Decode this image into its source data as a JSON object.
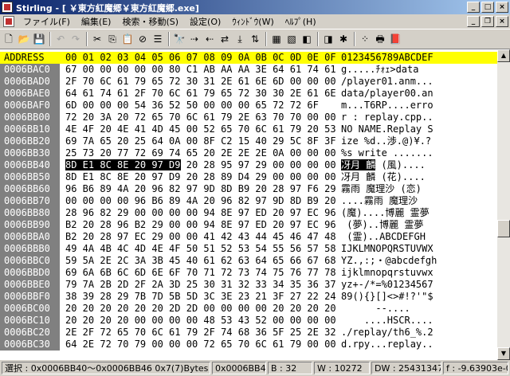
{
  "window": {
    "title": "Stirling - [ ￥東方紅魔郷￥東方紅魔郷.exe]",
    "minimize_icon": "minimize-icon",
    "maximize_icon": "maximize-icon",
    "close_icon": "close-icon"
  },
  "menu": {
    "items": [
      "ファイル(F)",
      "編集(E)",
      "検索・移動(S)",
      "設定(O)",
      "ｳｨﾝﾄﾞｳ(W)",
      "ﾍﾙﾌﾟ(H)"
    ]
  },
  "toolbar": {
    "icons": [
      "new-file-icon",
      "open-folder-icon",
      "save-icon",
      "undo-icon",
      "redo-icon",
      "cut-icon",
      "copy-icon",
      "paste-icon",
      "delete-icon",
      "select-all-icon",
      "find-icon",
      "find-next-icon",
      "find-prev-icon",
      "replace-icon",
      "jump-icon",
      "byte-order-icon",
      "insert-mode-icon",
      "overwrite-mode-icon",
      "prev-tag-icon",
      "next-tag-icon",
      "marker-icon",
      "random-icon",
      "print-icon",
      "help-book-icon"
    ]
  },
  "hex": {
    "header": {
      "address": "ADDRESS",
      "bytes": "00 01 02 03 04 05 06 07 08 09 0A 0B 0C 0D 0E 0F",
      "ascii": "0123456789ABCDEF"
    },
    "rows": [
      {
        "addr": "0006BAC0",
        "bytes": "67 00 00 00 00 00 80 C1 AB AA AA 3E 64 61 74 61",
        "ascii": "g.....ﾁｫｪ>data"
      },
      {
        "addr": "0006BAD0",
        "bytes": "2F 70 6C 61 79 65 72 30 31 2E 61 6E 6D 00 00 00",
        "ascii": "/player01.anm..."
      },
      {
        "addr": "0006BAE0",
        "bytes": "64 61 74 61 2F 70 6C 61 79 65 72 30 30 2E 61 6E",
        "ascii": "data/player00.an"
      },
      {
        "addr": "0006BAF0",
        "bytes": "6D 00 00 00 54 36 52 50 00 00 00 65 72 72 6F",
        "ascii": "m...T6RP....erro"
      },
      {
        "addr": "0006BB00",
        "bytes": "72 20 3A 20 72 65 70 6C 61 79 2E 63 70 70 00 00",
        "ascii": "r : replay.cpp.."
      },
      {
        "addr": "0006BB10",
        "bytes": "4E 4F 20 4E 41 4D 45 00 52 65 70 6C 61 79 20 53",
        "ascii": "NO NAME.Replay S"
      },
      {
        "addr": "0006BB20",
        "bytes": "69 7A 65 20 25 64 0A 00 8F C2 15 40 29 5C 8F 3F",
        "ascii": "ize %d..渉.@)¥.?"
      },
      {
        "addr": "0006BB30",
        "bytes": "25 73 20 77 72 69 74 65 20 2E 2E 2E 0A 00 00 00",
        "ascii": "%s write ......."
      },
      {
        "addr": "0006BB40",
        "bytes": "8D E1 8C 8E 20 97 D9 20 28 95 97 29 00 00 00 00",
        "ascii": "冴月 麟 (風)....",
        "sel_bytes": "8D E1 8C 8E 20 97 D9",
        "sel_ascii": "冴月 麟"
      },
      {
        "addr": "0006BB50",
        "bytes": "8D E1 8C 8E 20 97 D9 20 28 89 D4 29 00 00 00 00",
        "ascii": "冴月 麟 (花)...."
      },
      {
        "addr": "0006BB60",
        "bytes": "96 B6 89 4A 20 96 82 97 9D 8D B9 20 28 97 F6 29",
        "ascii": "霧雨 魔理沙 (恋)"
      },
      {
        "addr": "0006BB70",
        "bytes": "00 00 00 00 96 B6 89 4A 20 96 82 97 9D 8D B9 20",
        "ascii": "....霧雨 魔理沙 "
      },
      {
        "addr": "0006BB80",
        "bytes": "28 96 82 29 00 00 00 00 94 8E 97 ED 20 97 EC 96",
        "ascii": "(魔)....博麗 霊夢"
      },
      {
        "addr": "0006BB90",
        "bytes": "B2 20 28 96 B2 29 00 00 94 8E 97 ED 20 97 EC 96",
        "ascii": " (夢)..博麗 霊夢"
      },
      {
        "addr": "0006BBA0",
        "bytes": "B2 20 28 97 EC 29 00 00 41 42 43 44 45 46 47 48",
        "ascii": " (霊)..ABCDEFGH"
      },
      {
        "addr": "0006BBB0",
        "bytes": "49 4A 4B 4C 4D 4E 4F 50 51 52 53 54 55 56 57 58",
        "ascii": "IJKLMNOPQRSTUVWX"
      },
      {
        "addr": "0006BBC0",
        "bytes": "59 5A 2E 2C 3A 3B 45 40 61 62 63 64 65 66 67 68",
        "ascii": "YZ.,:;・@abcdefgh"
      },
      {
        "addr": "0006BBD0",
        "bytes": "69 6A 6B 6C 6D 6E 6F 70 71 72 73 74 75 76 77 78",
        "ascii": "ijklmnopqrstuvwx"
      },
      {
        "addr": "0006BBE0",
        "bytes": "79 7A 2B 2D 2F 2A 3D 25 30 31 32 33 34 35 36 37",
        "ascii": "yz+-/*=%01234567"
      },
      {
        "addr": "0006BBF0",
        "bytes": "38 39 28 29 7B 7D 5B 5D 3C 3E 23 21 3F 27 22 24",
        "ascii": "89(){}[]<>#!?'\"$"
      },
      {
        "addr": "0006BC00",
        "bytes": "20 20 20 20 20 20 2D 2D 00 00 00 00 20 20 20 20",
        "ascii": "      --....    "
      },
      {
        "addr": "0006BC10",
        "bytes": "20 20 20 20 00 00 00 00 48 53 43 52 00 00 00 00",
        "ascii": "    ....HSCR...."
      },
      {
        "addr": "0006BC20",
        "bytes": "2E 2F 72 65 70 6C 61 79 2F 74 68 36 5F 25 2E 32",
        "ascii": "./replay/th6_%.2"
      },
      {
        "addr": "0006BC30",
        "bytes": "64 2E 72 70 79 00 00 00 72 65 70 6C 61 79 00 00",
        "ascii": "d.rpy...replay.."
      }
    ]
  },
  "status": {
    "selection": "選択 : 0x0006BB40～0x0006BB46  0x7(7)Bytes",
    "address": "0x0006BB47",
    "byte": "B : 32",
    "word": "W : 10272",
    "dword": "DW : 2543134752",
    "float": "f : -9.63903e-025"
  },
  "colors": {
    "highlight_row": "#ffff00",
    "address_column": "#808080",
    "selection": "#000000"
  }
}
